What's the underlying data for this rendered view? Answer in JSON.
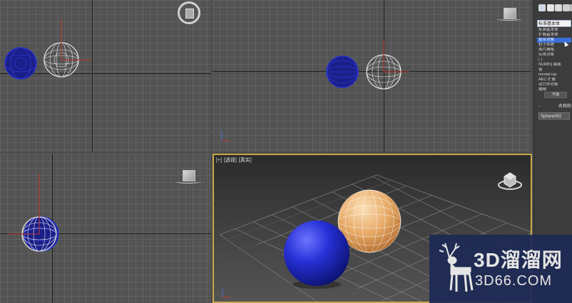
{
  "viewports": {
    "perspective": {
      "labels": [
        "[+]",
        "[透视]",
        "[真实]"
      ]
    }
  },
  "panel": {
    "toolbar_icons": [
      "create-geometry-icon",
      "shapes-icon",
      "lights-icon",
      "cameras-icon",
      "helpers-icon"
    ],
    "category_dropdown": "标准基本体",
    "category_list": [
      {
        "label": "标准基本体",
        "selected": false
      },
      {
        "label": "扩展基本体",
        "selected": false
      },
      {
        "label": "复合对象",
        "selected": true
      },
      {
        "label": "粒子系统",
        "selected": false
      },
      {
        "label": "面片栅格",
        "selected": false
      },
      {
        "label": "实体对象",
        "selected": false
      },
      {
        "label": "门",
        "selected": false
      },
      {
        "label": "NURBS 曲面",
        "selected": false
      },
      {
        "label": "窗",
        "selected": false
      },
      {
        "label": "mental ray",
        "selected": false
      },
      {
        "label": "AEC 扩展",
        "selected": false
      },
      {
        "label": "动力学对象",
        "selected": false
      },
      {
        "label": "楼梯",
        "selected": false
      }
    ],
    "small_button": "平面",
    "name_section": {
      "collapse": "-",
      "title": "名称和"
    },
    "object_name": "Sphere002"
  },
  "watermark": {
    "title": "3D溜溜网",
    "subtitle": "3D66.COM"
  },
  "colors": {
    "selected_sphere": "#f0f0f0",
    "blue_sphere": "#1f2bd0",
    "orange_sphere": "#e8b27a",
    "active_border": "#c8a84b",
    "selection": "#3a6fd8"
  }
}
